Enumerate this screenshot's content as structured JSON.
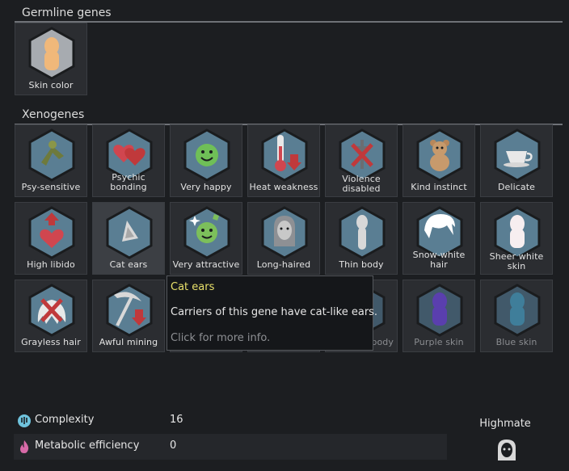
{
  "sections": {
    "germline": "Germline genes",
    "xenogenes": "Xenogenes"
  },
  "germline_genes": [
    {
      "label": "Skin color",
      "icon": "skin-color-icon"
    }
  ],
  "xenogenes": [
    {
      "label": "Psy-sensitive",
      "icon": "psy-sensitive-icon"
    },
    {
      "label": "Psychic bonding",
      "icon": "psychic-bonding-icon"
    },
    {
      "label": "Very happy",
      "icon": "very-happy-icon"
    },
    {
      "label": "Heat weakness",
      "icon": "heat-weakness-icon"
    },
    {
      "label": "Violence disabled",
      "icon": "violence-disabled-icon"
    },
    {
      "label": "Kind instinct",
      "icon": "kind-instinct-icon"
    },
    {
      "label": "Delicate",
      "icon": "delicate-icon"
    },
    {
      "label": "High libido",
      "icon": "high-libido-icon"
    },
    {
      "label": "Cat ears",
      "icon": "cat-ears-icon"
    },
    {
      "label": "Very attractive",
      "icon": "very-attractive-icon"
    },
    {
      "label": "Long-haired",
      "icon": "long-haired-icon"
    },
    {
      "label": "Thin body",
      "icon": "thin-body-icon"
    },
    {
      "label": "Snow-white hair",
      "icon": "snow-white-hair-icon"
    },
    {
      "label": "Sheer white skin",
      "icon": "sheer-white-skin-icon"
    },
    {
      "label": "Grayless hair",
      "icon": "grayless-hair-icon"
    },
    {
      "label": "Awful mining",
      "icon": "awful-mining-icon"
    },
    {
      "label": "",
      "icon": ""
    },
    {
      "label": "",
      "icon": ""
    },
    {
      "label": "body",
      "icon": "body-icon"
    },
    {
      "label": "Purple skin",
      "icon": "purple-skin-icon"
    },
    {
      "label": "Blue skin",
      "icon": "blue-skin-icon"
    }
  ],
  "tooltip": {
    "title": "Cat ears",
    "description": "Carriers of this gene have cat-like ears.",
    "hint": "Click for more info."
  },
  "stats": {
    "complexity": {
      "label": "Complexity",
      "value": "16",
      "icon": "complexity-icon"
    },
    "metabolic": {
      "label": "Metabolic efficiency",
      "value": "0",
      "icon": "metabolic-icon"
    }
  },
  "xenotype": {
    "name": "Highmate",
    "icon": "highmate-xenotype-icon"
  },
  "colors": {
    "hex_fill": "#5a7e93",
    "hex_border": "#1a1c1e",
    "tooltip_title": "#e8e06a",
    "accent_red": "#c0393b"
  }
}
